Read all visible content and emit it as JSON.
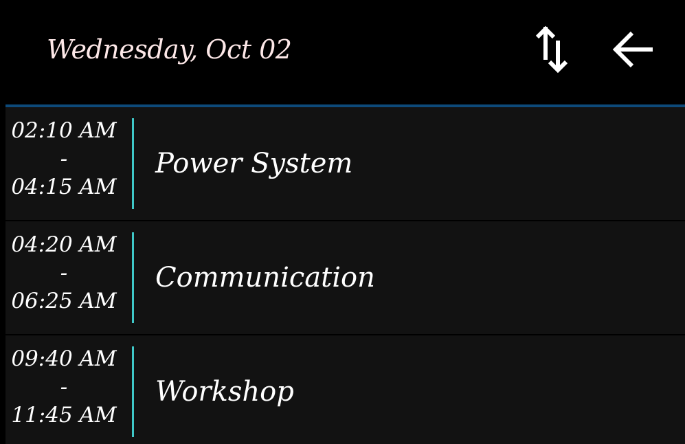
{
  "header": {
    "title": "Wednesday, Oct 02",
    "sort_icon": "swap-vertical-icon",
    "back_icon": "arrow-left-icon"
  },
  "colors": {
    "background": "#000000",
    "row_background": "#121212",
    "accent_bar": "#3fc8c8",
    "divider": "#0d4a7a",
    "title_text": "#fde8e8"
  },
  "events": [
    {
      "start": "02:10 AM",
      "separator": "-",
      "end": "04:15 AM",
      "title": "Power System"
    },
    {
      "start": "04:20 AM",
      "separator": "-",
      "end": "06:25 AM",
      "title": "Communication"
    },
    {
      "start": "09:40 AM",
      "separator": "-",
      "end": "11:45 AM",
      "title": "Workshop"
    }
  ]
}
